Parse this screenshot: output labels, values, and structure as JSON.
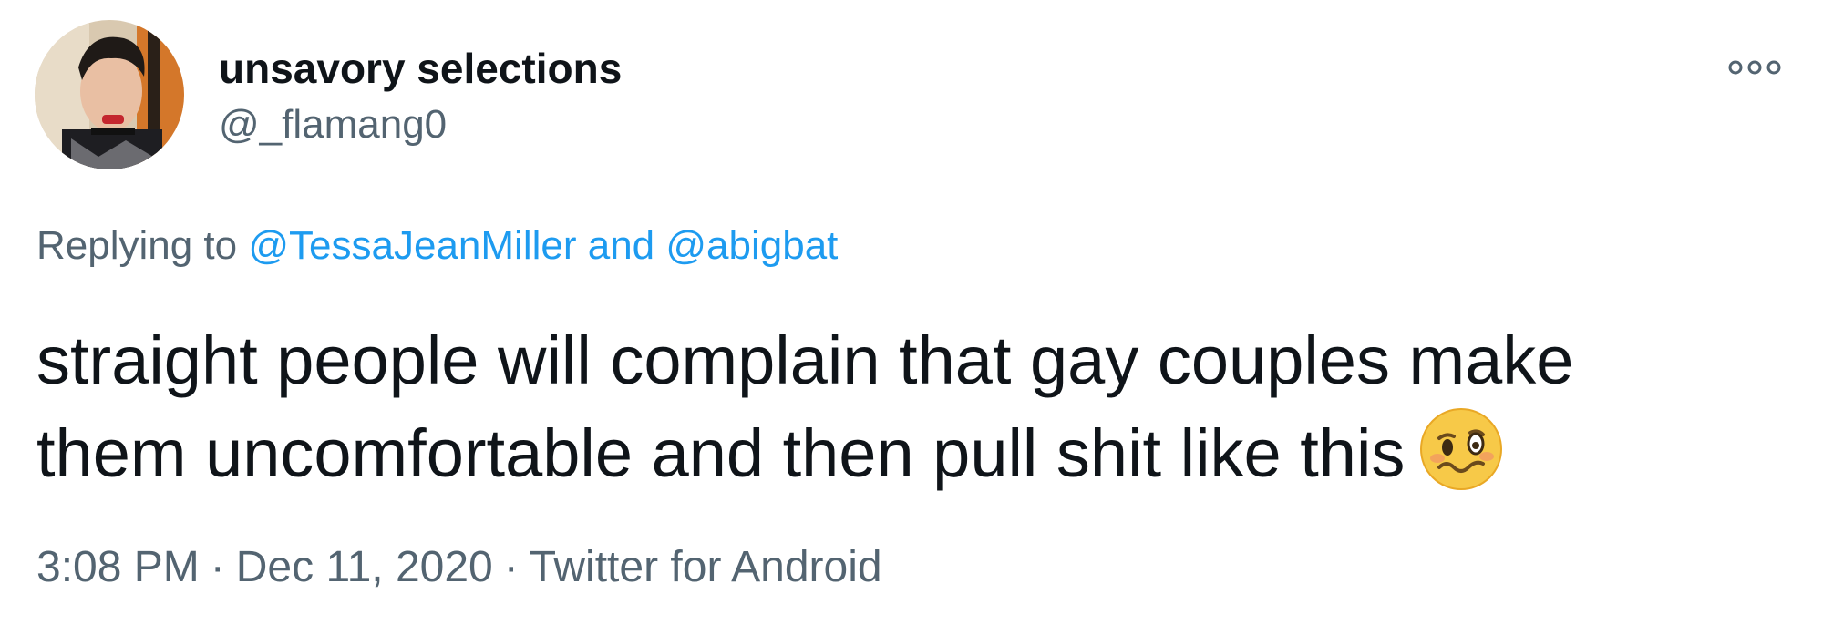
{
  "user": {
    "display_name": "unsavory selections",
    "handle": "@_flamang0",
    "avatar_icon": "profile-photo"
  },
  "more_icon": "more-horizontal-icon",
  "reply": {
    "prefix": "Replying to",
    "mention1": "@TessaJeanMiller",
    "conjunction": "and",
    "mention2": "@abigbat"
  },
  "tweet": {
    "line1": "straight people will complain that gay couples make",
    "line2": "them uncomfortable and then pull shit like this",
    "emoji": "woozy-face-emoji"
  },
  "meta": {
    "time": "3:08 PM",
    "separator": "·",
    "date": "Dec 11, 2020",
    "source": "Twitter for Android"
  },
  "colors": {
    "text": "#0f1419",
    "secondary": "#536471",
    "link": "#1d9bf0",
    "emoji": "#f7c948"
  }
}
